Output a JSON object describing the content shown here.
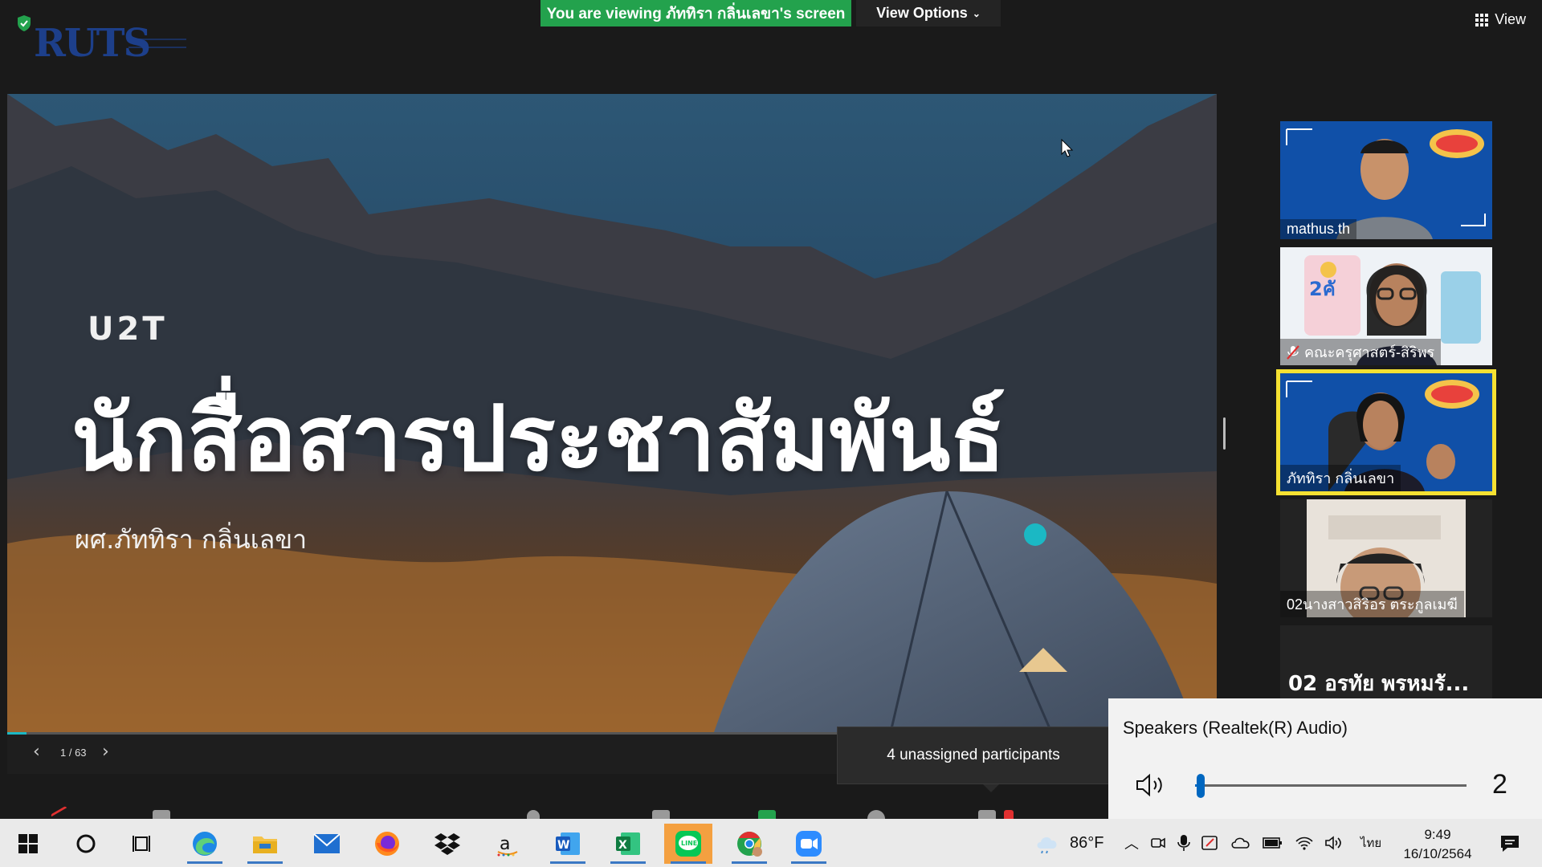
{
  "app": {
    "logo_text": "RUTS",
    "viewing_banner": "You are viewing ภัททิรา กลิ่นเลขา's screen",
    "view_options_label": "View Options",
    "view_button_label": "View"
  },
  "slide": {
    "brand": "U2T",
    "title": "นักสื่อสารประชาสัมพันธ์",
    "subtitle": "ผศ.ภัททิรา กลิ่นเลขา",
    "counter": "1 / 63",
    "progress_fraction": 0.016
  },
  "participants": [
    {
      "name": "mathus.th",
      "muted": false
    },
    {
      "name": "คณะครุศาสตร์-สิริพร",
      "muted": true
    },
    {
      "name": "ภัททิรา กลิ่นเลขา",
      "muted": false,
      "active": true
    },
    {
      "name": "02นางสาวสิริอร ตระกูลเมฆี",
      "muted": false
    },
    {
      "name": "02 อรทัย พรหมรั...",
      "muted": false
    }
  ],
  "toast": "4 unassigned participants",
  "volume": {
    "device": "Speakers (Realtek(R) Audio)",
    "level": 2
  },
  "taskbar": {
    "weather_temp": "86°F",
    "language": "ไทย",
    "time": "9:49",
    "date": "16/10/2564",
    "apps": [
      "windows-start",
      "cortana",
      "task-view",
      "edge",
      "file-explorer",
      "mail",
      "firefox",
      "dropbox",
      "amazon",
      "word",
      "excel",
      "line",
      "chrome",
      "zoom"
    ]
  },
  "colors": {
    "banner_green": "#23a24d",
    "active_speaker": "#f5e132",
    "accent_blue": "#0067c0",
    "slide_dot": "#1bb8c4"
  }
}
